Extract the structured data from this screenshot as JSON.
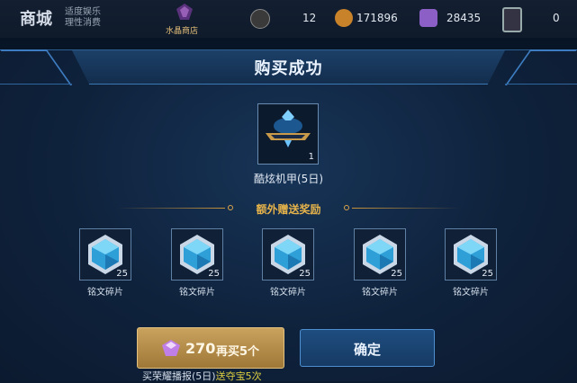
{
  "topbar": {
    "title": "商城",
    "subtitle_line1": "适度娱乐",
    "subtitle_line2": "理性消费",
    "crystal_shop_label": "水晶商店",
    "currency1_value": "12",
    "currency2_value": "171896",
    "currency3_value": "28435",
    "currency4_value": "0"
  },
  "dialog": {
    "title": "购买成功",
    "main_item": {
      "name": "酷炫机甲(5日)",
      "count": "1"
    },
    "reward_header": "额外赠送奖励",
    "rewards": [
      {
        "name": "铭文碎片",
        "count": "25"
      },
      {
        "name": "铭文碎片",
        "count": "25"
      },
      {
        "name": "铭文碎片",
        "count": "25"
      },
      {
        "name": "铭文碎片",
        "count": "25"
      },
      {
        "name": "铭文碎片",
        "count": "25"
      }
    ],
    "buy_again": {
      "price": "270",
      "label": "再买5个"
    },
    "confirm_label": "确定",
    "footnote": {
      "text": "买荣耀播报(5日)",
      "highlight": "送夺宝5次"
    }
  },
  "colors": {
    "accent_gold": "#e6b34a",
    "dialog_border": "#3b78b4",
    "crystal_blue": "#6fd3f5"
  }
}
